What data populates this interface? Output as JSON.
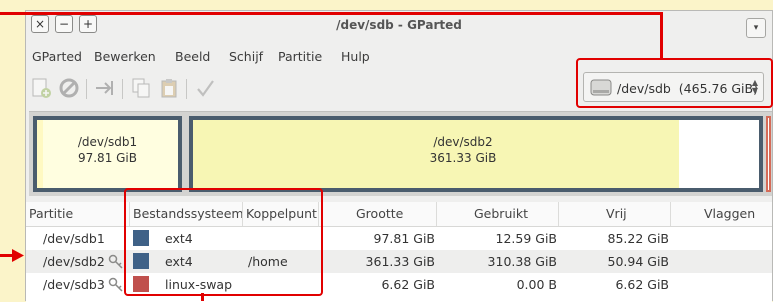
{
  "window": {
    "title": "/dev/sdb - GParted",
    "controls": [
      "×",
      "−",
      "+"
    ],
    "menu_button_glyph": "▾"
  },
  "menubar": {
    "items": [
      "GParted",
      "Bewerken",
      "Beeld",
      "Schijf",
      "Partitie",
      "Hulp"
    ]
  },
  "toolbar": {
    "icons": [
      "new-partition-icon",
      "delete-icon",
      "resize-move-icon",
      "copy-icon",
      "paste-icon",
      "apply-icon"
    ]
  },
  "device_selector": {
    "device": "/dev/sdb",
    "size": "(465.76 GiB)",
    "spin_up": "▲",
    "spin_down": "▼"
  },
  "partition_map": {
    "blocks": [
      {
        "name": "/dev/sdb1",
        "size": "97.81 GiB",
        "fill_color": "#fffee0",
        "used_color": "#fffee0",
        "border_color": "#4a5c6d"
      },
      {
        "name": "/dev/sdb2",
        "size": "361.33 GiB",
        "fill_color": "#ffffff",
        "used_color": "#f7f6b4",
        "border_color": "#4a5c6d"
      },
      {
        "name": "",
        "size": "",
        "fill_color": "#ffffff",
        "border_color": "#d56b58"
      }
    ]
  },
  "table": {
    "columns": [
      "Partitie",
      "Bestandssysteem",
      "Koppelpunt",
      "Grootte",
      "Gebruikt",
      "Vrij",
      "Vlaggen"
    ],
    "rows": [
      {
        "partition": "/dev/sdb1",
        "filesystem": "ext4",
        "fs_color": "#3f6187",
        "mountpoint": "",
        "size": "97.81 GiB",
        "used": "12.59 GiB",
        "free": "85.22 GiB",
        "flags": "",
        "locked": false
      },
      {
        "partition": "/dev/sdb2",
        "filesystem": "ext4",
        "fs_color": "#3f6187",
        "mountpoint": "/home",
        "size": "361.33 GiB",
        "used": "310.38 GiB",
        "free": "50.94 GiB",
        "flags": "",
        "locked": true
      },
      {
        "partition": "/dev/sdb3",
        "filesystem": "linux-swap",
        "fs_color": "#c0504d",
        "mountpoint": "",
        "size": "6.62 GiB",
        "used": "0.00 B",
        "free": "6.62 GiB",
        "flags": "",
        "locked": true
      }
    ],
    "selected_row": 1
  },
  "annotation_color": "#e10000"
}
